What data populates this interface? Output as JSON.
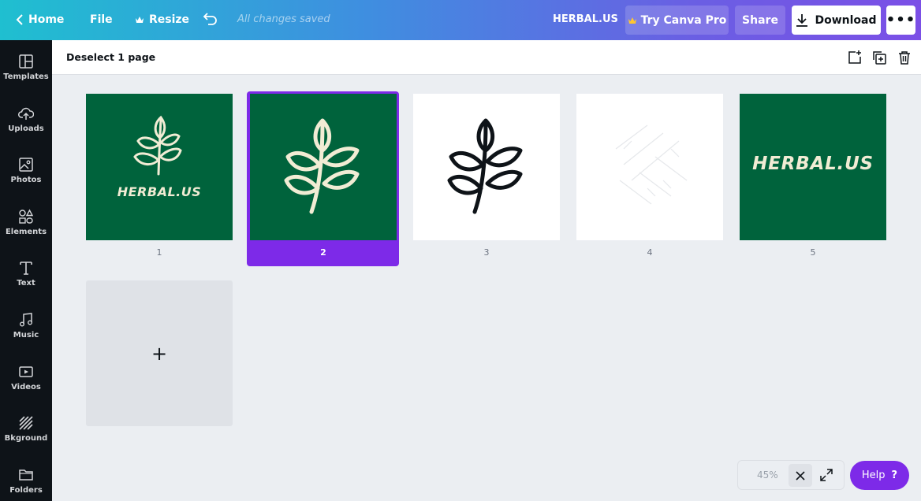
{
  "topbar": {
    "home_label": "Home",
    "file_label": "File",
    "resize_label": "Resize",
    "saved_status": "All changes saved",
    "design_title": "HERBAL.US",
    "try_pro_label": "Try Canva Pro",
    "share_label": "Share",
    "download_label": "Download",
    "more_label": "•••"
  },
  "sidebar": {
    "items": [
      {
        "label": "Templates",
        "icon": "templates-icon"
      },
      {
        "label": "Uploads",
        "icon": "uploads-icon"
      },
      {
        "label": "Photos",
        "icon": "photos-icon"
      },
      {
        "label": "Elements",
        "icon": "elements-icon"
      },
      {
        "label": "Text",
        "icon": "text-icon"
      },
      {
        "label": "Music",
        "icon": "music-icon"
      },
      {
        "label": "Videos",
        "icon": "videos-icon"
      },
      {
        "label": "Bkground",
        "icon": "background-icon"
      },
      {
        "label": "Folders",
        "icon": "folders-icon"
      }
    ]
  },
  "subheader": {
    "deselect_label": "Deselect 1 page"
  },
  "pages": [
    {
      "number": "1",
      "text": "HERBAL.US"
    },
    {
      "number": "2"
    },
    {
      "number": "3"
    },
    {
      "number": "4"
    },
    {
      "number": "5",
      "text": "HERBAL.US"
    }
  ],
  "add_page_label": "+",
  "zoom": {
    "value": "45%"
  },
  "help_label": "Help",
  "help_icon_label": "?",
  "colors": {
    "accent": "#7d2ae8",
    "brand_green": "#00633c",
    "leaf_cream": "#f1ecd4"
  }
}
